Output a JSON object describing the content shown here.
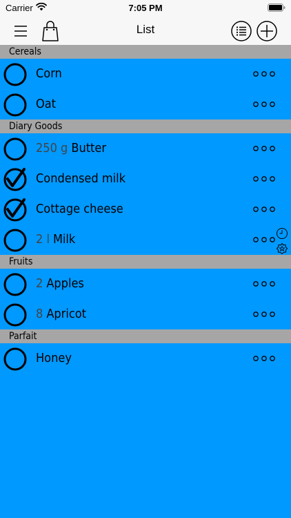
{
  "status_bar": {
    "carrier": "Carrier",
    "time": "7:05 PM"
  },
  "nav": {
    "title": "List",
    "icons": [
      "menu-icon",
      "shopping-bag-icon",
      "list-icon",
      "add-icon"
    ]
  },
  "colors": {
    "row_background": "#0099ff",
    "section_background": "#a6a6a6",
    "quantity_text": "#444444"
  },
  "sections": [
    {
      "title": "Cereals",
      "items": [
        {
          "qty": "",
          "name": "Corn",
          "checked": false
        },
        {
          "qty": "",
          "name": "Oat",
          "checked": false
        }
      ]
    },
    {
      "title": "Diary Goods",
      "items": [
        {
          "qty": "250 g",
          "name": "Butter",
          "checked": false
        },
        {
          "qty": "",
          "name": "Condensed milk",
          "checked": true
        },
        {
          "qty": "",
          "name": "Cottage cheese",
          "checked": true
        },
        {
          "qty": "2 l",
          "name": "Milk",
          "checked": false,
          "reminder": true
        }
      ]
    },
    {
      "title": "Fruits",
      "items": [
        {
          "qty": "2",
          "name": "Apples",
          "checked": false
        },
        {
          "qty": "8",
          "name": "Apricot",
          "checked": false
        }
      ]
    },
    {
      "title": "Parfait",
      "items": [
        {
          "qty": "",
          "name": "Honey",
          "checked": false
        }
      ]
    }
  ]
}
